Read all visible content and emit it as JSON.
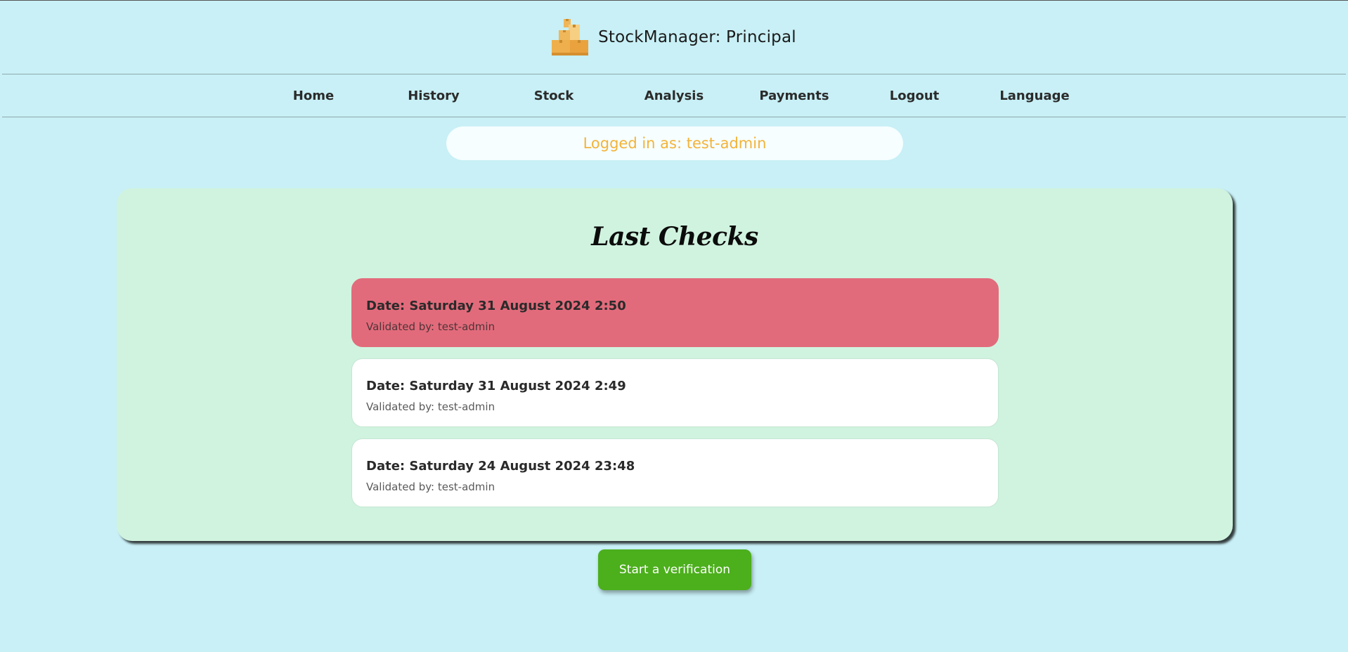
{
  "header": {
    "title": "StockManager: Principal",
    "logo_icon": "boxes-icon"
  },
  "nav": {
    "items": [
      "Home",
      "History",
      "Stock",
      "Analysis",
      "Payments",
      "Logout",
      "Language"
    ]
  },
  "session": {
    "logged_in_text": "Logged in as: test-admin"
  },
  "panel": {
    "title": "Last Checks",
    "checks": [
      {
        "date": "Date: Saturday 31 August 2024 2:50",
        "validated": "Validated by: test-admin",
        "status": "alert"
      },
      {
        "date": "Date: Saturday 31 August 2024 2:49",
        "validated": "Validated by: test-admin",
        "status": "ok"
      },
      {
        "date": "Date: Saturday 24 August 2024 23:48",
        "validated": "Validated by: test-admin",
        "status": "ok"
      }
    ]
  },
  "actions": {
    "start_verification_label": "Start a verification"
  },
  "colors": {
    "background": "#c8f0f6",
    "panel": "#d0f3df",
    "alert_card": "#e26b7b",
    "login_text": "#f3b33a",
    "primary_button": "#4caf1c"
  }
}
